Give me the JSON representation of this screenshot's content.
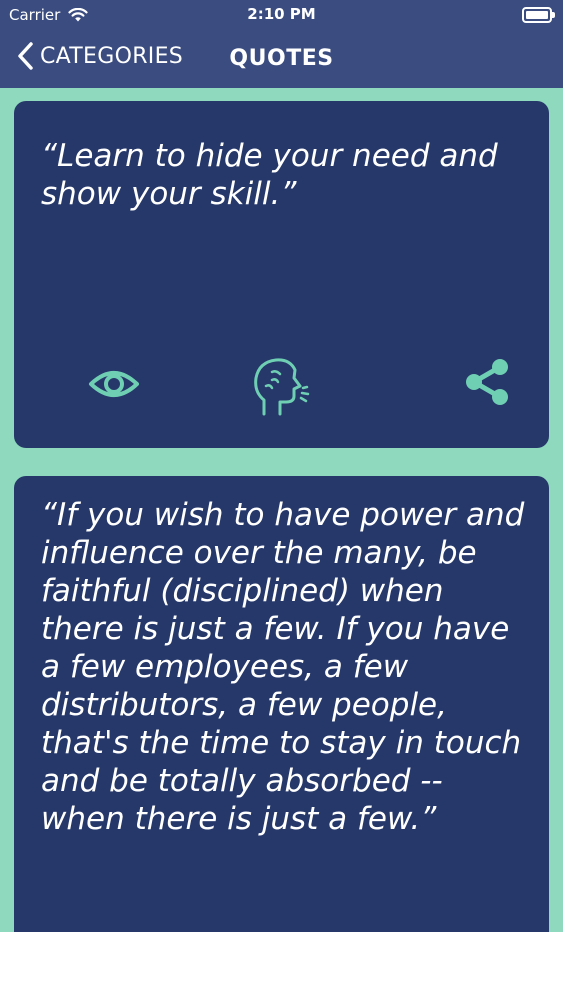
{
  "status_bar": {
    "carrier": "Carrier",
    "time": "2:10 PM"
  },
  "nav": {
    "back_label": "CATEGORIES",
    "title": "QUOTES"
  },
  "quotes": [
    {
      "text": "“Learn to hide your need and show your skill.”"
    },
    {
      "text": "“If you wish to have power and influence over the many, be faithful (disciplined) when there is just a few. If you have a few employees, a few distributors, a few people, that's the time to stay in touch and be totally absorbed -- when there is just a few.”"
    }
  ],
  "actions": {
    "view_icon": "eye-icon",
    "speak_icon": "speaking-head-icon",
    "share_icon": "share-icon"
  },
  "colors": {
    "header": "#3b4d80",
    "background": "#8fd9bf",
    "card": "#26386a",
    "icon": "#6fcfb3"
  }
}
